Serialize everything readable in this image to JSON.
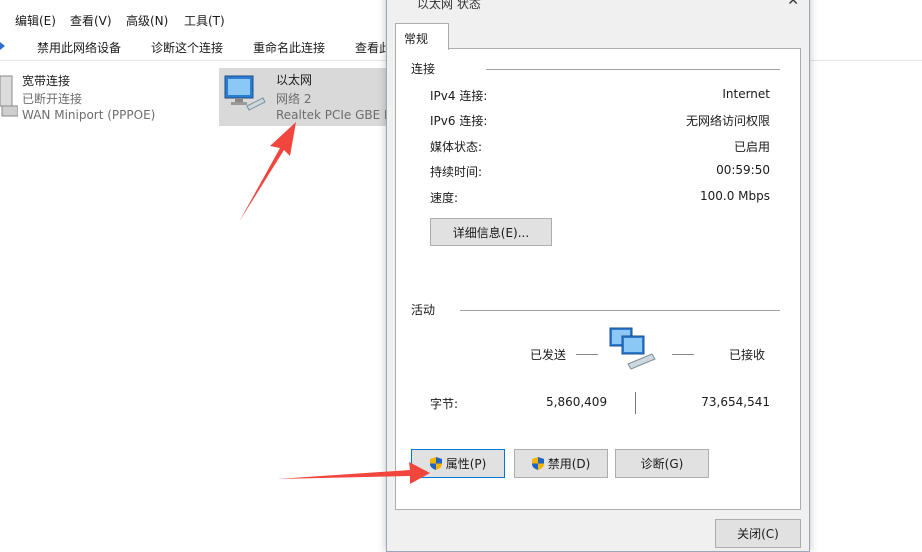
{
  "menubar": {
    "items": [
      "编辑(E)",
      "查看(V)",
      "高级(N)",
      "工具(T)"
    ]
  },
  "toolbar": {
    "items": [
      "禁用此网络设备",
      "诊断这个连接",
      "重命名此连接",
      "查看此"
    ]
  },
  "connections": [
    {
      "name": "宽带连接",
      "status": "已断开连接",
      "device": "WAN Miniport (PPPOE)"
    },
    {
      "name": "以太网",
      "status": "网络 2",
      "device": "Realtek PCIe GBE F"
    }
  ],
  "dialog": {
    "title": "以太网 状态",
    "close": "✕",
    "tab": "常规",
    "connection_group": "连接",
    "rows": [
      {
        "label": "IPv4 连接:",
        "value": "Internet"
      },
      {
        "label": "IPv6 连接:",
        "value": "无网络访问权限"
      },
      {
        "label": "媒体状态:",
        "value": "已启用"
      },
      {
        "label": "持续时间:",
        "value": "00:59:50"
      },
      {
        "label": "速度:",
        "value": "100.0 Mbps"
      }
    ],
    "details_button": "详细信息(E)...",
    "activity_group": "活动",
    "sent_label": "已发送",
    "received_label": "已接收",
    "bytes_label": "字节:",
    "bytes_sent": "5,860,409",
    "bytes_received": "73,654,541",
    "properties_button": "属性(P)",
    "disable_button": "禁用(D)",
    "diagnose_button": "诊断(G)",
    "close_button": "关闭(C)"
  },
  "colors": {
    "arrow": "#f2453d",
    "selection": "#d9d9d9",
    "dialog_bg": "#f0f0f0"
  }
}
